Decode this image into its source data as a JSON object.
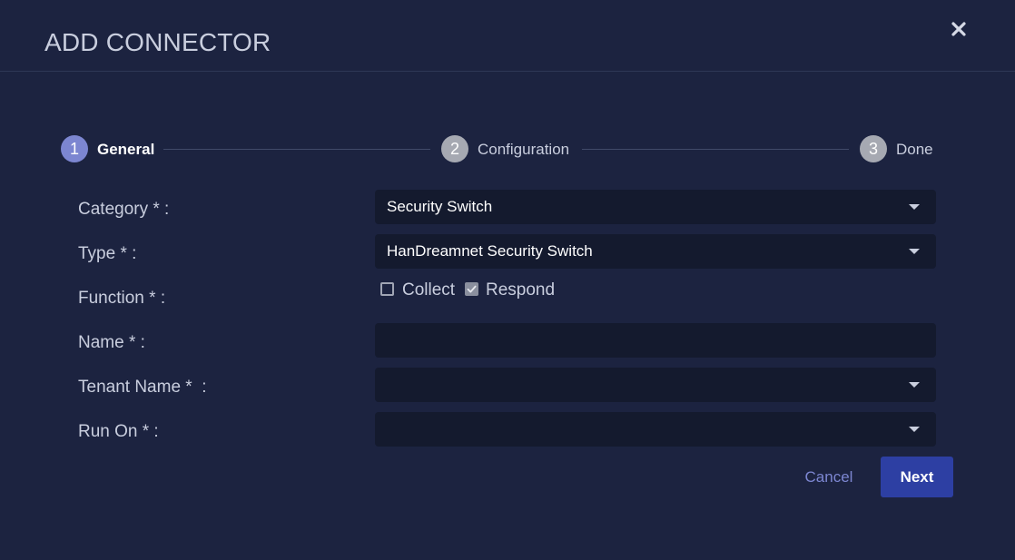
{
  "dialog": {
    "title": "ADD CONNECTOR",
    "close_icon": "close-icon"
  },
  "stepper": {
    "steps": [
      {
        "number": "1",
        "label": "General",
        "state": "active"
      },
      {
        "number": "2",
        "label": "Configuration",
        "state": "inactive"
      },
      {
        "number": "3",
        "label": "Done",
        "state": "inactive"
      }
    ]
  },
  "form": {
    "category": {
      "label": "Category * :",
      "value": "Security Switch",
      "icon": "chevron-down-icon"
    },
    "type": {
      "label": "Type * :",
      "value": "HanDreamnet Security Switch",
      "icon": "chevron-down-icon"
    },
    "function": {
      "label": "Function * :",
      "options": [
        {
          "label": "Collect",
          "checked": false
        },
        {
          "label": "Respond",
          "checked": true
        }
      ]
    },
    "name": {
      "label": "Name * :",
      "value": ""
    },
    "tenant_name": {
      "label": "Tenant Name *  :",
      "value": "",
      "icon": "chevron-down-icon"
    },
    "run_on": {
      "label": "Run On * :",
      "value": "",
      "icon": "chevron-down-icon"
    }
  },
  "actions": {
    "cancel_label": "Cancel",
    "next_label": "Next"
  },
  "colors": {
    "background": "#1c2340",
    "field_background": "#141a2e",
    "accent": "#7c86d1",
    "primary_button": "#2d3fa3",
    "text": "#c9cede"
  }
}
